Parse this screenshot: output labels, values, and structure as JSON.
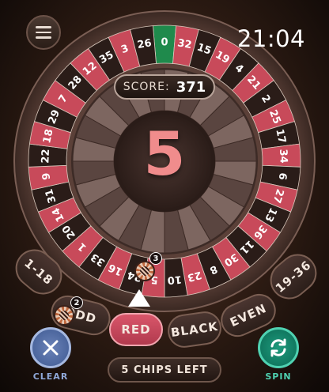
{
  "header": {
    "clock": "21:04",
    "menu_icon": "hamburger-icon"
  },
  "score": {
    "label": "SCORE:",
    "value": "371"
  },
  "result": {
    "number": "5"
  },
  "wheel": {
    "pockets": [
      {
        "n": "0",
        "c": "green"
      },
      {
        "n": "32",
        "c": "red"
      },
      {
        "n": "15",
        "c": "black"
      },
      {
        "n": "19",
        "c": "red"
      },
      {
        "n": "4",
        "c": "black"
      },
      {
        "n": "21",
        "c": "red"
      },
      {
        "n": "2",
        "c": "black"
      },
      {
        "n": "25",
        "c": "red"
      },
      {
        "n": "17",
        "c": "black"
      },
      {
        "n": "34",
        "c": "red"
      },
      {
        "n": "6",
        "c": "black"
      },
      {
        "n": "27",
        "c": "red"
      },
      {
        "n": "13",
        "c": "black"
      },
      {
        "n": "36",
        "c": "red"
      },
      {
        "n": "11",
        "c": "black"
      },
      {
        "n": "30",
        "c": "red"
      },
      {
        "n": "8",
        "c": "black"
      },
      {
        "n": "23",
        "c": "red"
      },
      {
        "n": "10",
        "c": "black"
      },
      {
        "n": "5",
        "c": "red"
      },
      {
        "n": "24",
        "c": "black"
      },
      {
        "n": "16",
        "c": "red"
      },
      {
        "n": "33",
        "c": "black"
      },
      {
        "n": "1",
        "c": "red"
      },
      {
        "n": "20",
        "c": "black"
      },
      {
        "n": "14",
        "c": "red"
      },
      {
        "n": "31",
        "c": "black"
      },
      {
        "n": "9",
        "c": "red"
      },
      {
        "n": "22",
        "c": "black"
      },
      {
        "n": "18",
        "c": "red"
      },
      {
        "n": "29",
        "c": "black"
      },
      {
        "n": "7",
        "c": "red"
      },
      {
        "n": "28",
        "c": "black"
      },
      {
        "n": "12",
        "c": "red"
      },
      {
        "n": "35",
        "c": "black"
      },
      {
        "n": "3",
        "c": "red"
      },
      {
        "n": "26",
        "c": "black"
      }
    ]
  },
  "bets": {
    "low": "1-18",
    "odd": "ODD",
    "red": "RED",
    "black": "BLACK",
    "even": "EVEN",
    "high": "19-36"
  },
  "chips": {
    "wheel_count": "3",
    "odd_count": "2"
  },
  "actions": {
    "clear": "CLEAR",
    "spin": "SPIN",
    "chips_left": "5 CHIPS LEFT"
  },
  "colors": {
    "red": "#c84a5a",
    "black": "#2a1c18",
    "green": "#1f8a4c",
    "spin": "#1d9a7c",
    "clear": "#6a82b8"
  }
}
